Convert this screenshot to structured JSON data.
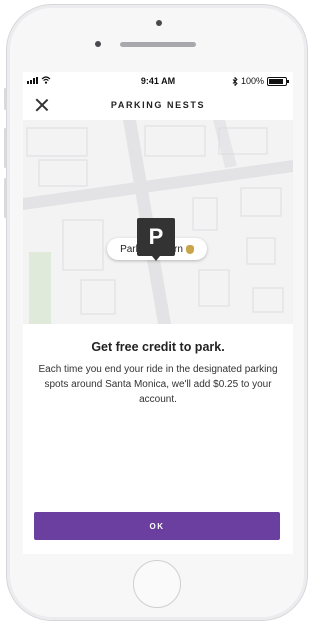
{
  "status_bar": {
    "time": "9:41 AM",
    "battery": "100%",
    "icons": [
      "signal-icon",
      "wifi-icon",
      "bluetooth-icon",
      "battery-icon"
    ]
  },
  "header": {
    "title": "PARKING NESTS",
    "close_icon": "close-icon"
  },
  "map": {
    "callout_text": "Park and earn",
    "callout_icon": "money-bag-icon",
    "marker_letter": "P"
  },
  "content": {
    "headline": "Get free credit to park.",
    "description": "Each time you end your ride in the designated parking spots around Santa Monica, we'll add $0.25 to your account."
  },
  "actions": {
    "ok_label": "OK"
  },
  "colors": {
    "accent": "#6b3fa0",
    "marker": "#333333"
  }
}
